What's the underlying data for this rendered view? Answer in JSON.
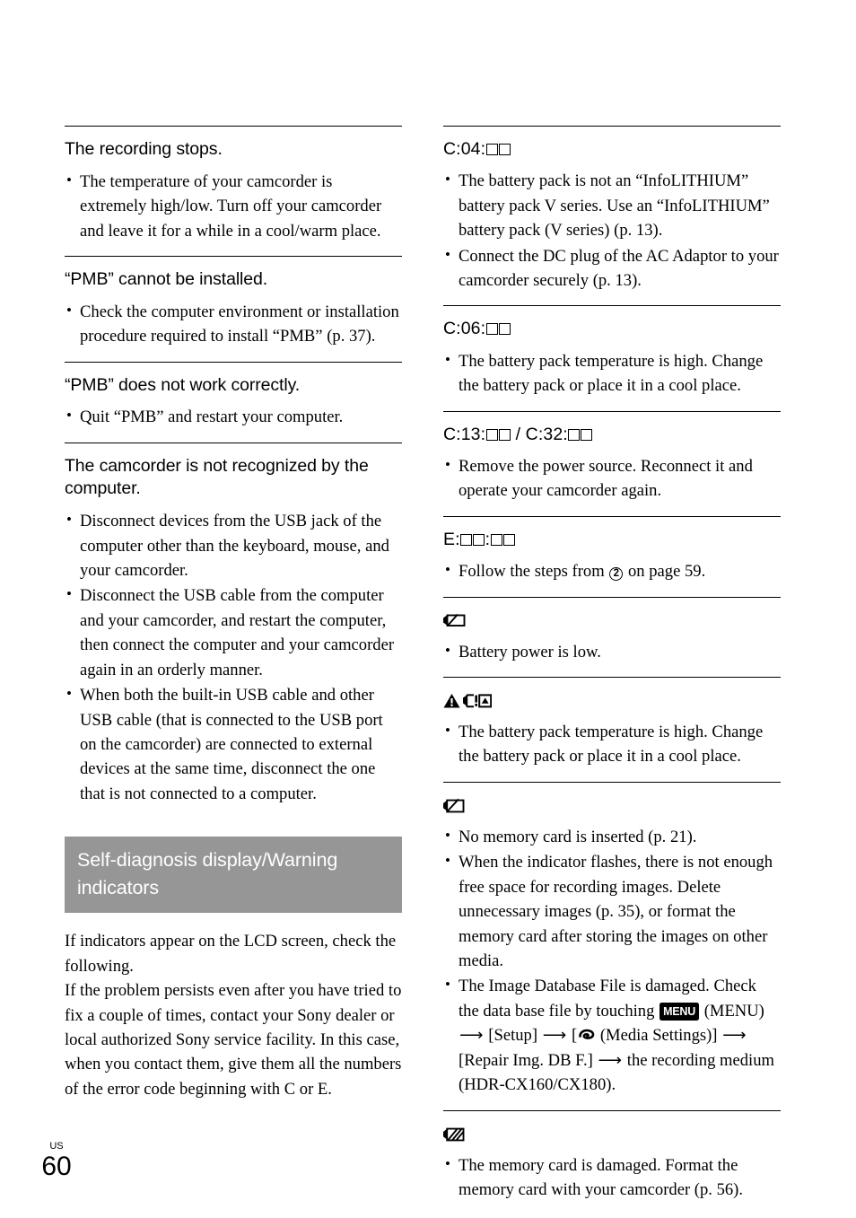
{
  "page": {
    "locale_mark": "US",
    "number": "60"
  },
  "left_column": {
    "sections": [
      {
        "heading": "The recording stops.",
        "bullets": [
          "The temperature of your camcorder is extremely high/low. Turn off your camcorder and leave it for a while in a cool/warm place."
        ]
      },
      {
        "heading": "“PMB” cannot be installed.",
        "bullets": [
          "Check the computer environment or installation procedure required to install “PMB” (p. 37)."
        ]
      },
      {
        "heading": "“PMB” does not work correctly.",
        "bullets": [
          "Quit “PMB” and restart your computer."
        ]
      },
      {
        "heading": "The camcorder is not recognized by the computer.",
        "bullets": [
          "Disconnect devices from the USB jack of the computer other than the keyboard, mouse, and your camcorder.",
          "Disconnect the USB cable from the computer and your camcorder, and restart the computer, then connect the computer and your camcorder again in an orderly manner.",
          "When both the built-in USB cable and other USB cable (that is connected to the USB port on the camcorder) are connected to external devices at the same time, disconnect the one that is not connected to a computer."
        ]
      }
    ],
    "banner": {
      "title": "Self-diagnosis display/Warning indicators",
      "background_color": "#969696",
      "text_color": "#ffffff"
    },
    "intro_paragraph_1": "If indicators appear on the LCD screen, check the following.",
    "intro_paragraph_2": "If the problem persists even after you have tried to fix a couple of times, contact your Sony dealer or local authorized Sony service facility. In this case, when you contact them, give them all the numbers of the error code beginning with C or E."
  },
  "right_column": {
    "sections": [
      {
        "code_prefix": "C:04:",
        "code_boxes": 2,
        "bullets": [
          "The battery pack is not an “InfoLITHIUM” battery pack V series. Use an “InfoLITHIUM” battery pack (V series) (p. 13).",
          "Connect the DC plug of the AC Adaptor to your camcorder securely (p. 13)."
        ]
      },
      {
        "code_prefix": "C:06:",
        "code_boxes": 2,
        "bullets": [
          "The battery pack temperature is high. Change the battery pack or place it in a cool place."
        ]
      },
      {
        "code_prefix_a": "C:13:",
        "code_separator": " / ",
        "code_prefix_b": "C:32:",
        "bullets": [
          "Remove the power source. Reconnect it and operate your camcorder again."
        ]
      },
      {
        "code_prefix": "E:",
        "code_middle": ":",
        "bullets_prefix": "Follow the steps from ",
        "circled_number": "2",
        "bullets_suffix": " on page 59."
      },
      {
        "icon": "low-battery-icon",
        "bullets": [
          "Battery power is low."
        ]
      },
      {
        "icon": "overheat-warning-icons",
        "bullets": [
          "The battery pack temperature is high. Change the battery pack or place it in a cool place."
        ]
      },
      {
        "icon": "no-memory-card-icon",
        "bullets": [
          "No memory card is inserted (p. 21).",
          "When the indicator flashes, there is not enough free space for recording images. Delete unnecessary images (p. 35), or format the memory card after storing the images on other media."
        ],
        "db_bullet": {
          "text_1": "The Image Database File is damaged. Check the data base file by touching ",
          "menu_badge": "MENU",
          "text_2": " (MENU) ",
          "text_3": " [Setup] ",
          "text_4": " [",
          "media_settings_label": " (Media Settings)] ",
          "text_5": "[Repair Img. DB F.] ",
          "text_6": " the recording medium (HDR-CX160/CX180)."
        }
      },
      {
        "icon": "damaged-memory-card-icon",
        "bullets": [
          "The memory card is damaged. Format the memory card with your camcorder (p. 56)."
        ]
      }
    ]
  }
}
